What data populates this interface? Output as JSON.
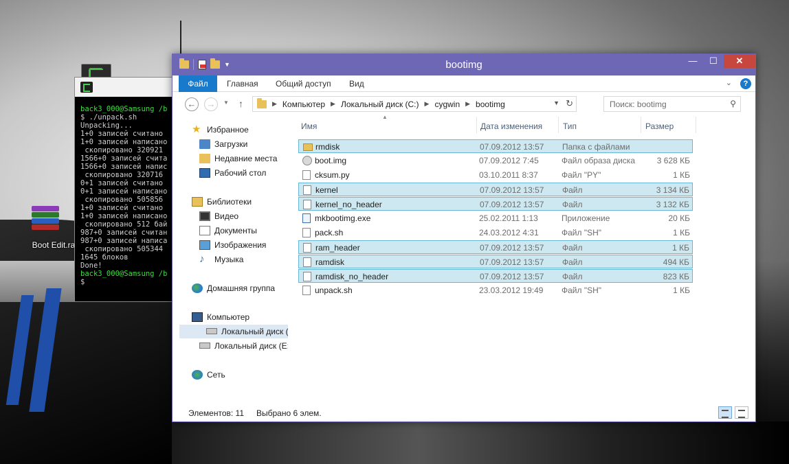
{
  "desktop": {
    "rar_label": "Boot Edit.rar"
  },
  "terminal": {
    "lines": [
      {
        "text": "back3_000@Samsung /b",
        "color": "green"
      },
      {
        "text": "$ ./unpack.sh",
        "color": "white"
      },
      {
        "text": "Unpacking...",
        "color": "white"
      },
      {
        "text": "1+0 записей считано",
        "color": "white"
      },
      {
        "text": "1+0 записей написано",
        "color": "white"
      },
      {
        "text": " скопировано 320921",
        "color": "white"
      },
      {
        "text": "1566+0 записей счита",
        "color": "white"
      },
      {
        "text": "1566+0 записей напис",
        "color": "white"
      },
      {
        "text": " скопировано 320716",
        "color": "white"
      },
      {
        "text": "0+1 записей считано",
        "color": "white"
      },
      {
        "text": "0+1 записей написано",
        "color": "white"
      },
      {
        "text": " скопировано 505856",
        "color": "white"
      },
      {
        "text": "1+0 записей считано",
        "color": "white"
      },
      {
        "text": "1+0 записей написано",
        "color": "white"
      },
      {
        "text": " скопировано 512 бай",
        "color": "white"
      },
      {
        "text": "987+0 записей считан",
        "color": "white"
      },
      {
        "text": "987+0 записей написа",
        "color": "white"
      },
      {
        "text": " скопировано 505344",
        "color": "white"
      },
      {
        "text": "1645 блоков",
        "color": "white"
      },
      {
        "text": "Done!",
        "color": "white"
      },
      {
        "text": "",
        "color": "white"
      },
      {
        "text": "back3_000@Samsung /b",
        "color": "green"
      },
      {
        "text": "$ ",
        "color": "white"
      }
    ]
  },
  "explorer": {
    "title": "bootimg",
    "ribbon_tabs": {
      "file": "Файл",
      "home": "Главная",
      "share": "Общий доступ",
      "view": "Вид"
    },
    "breadcrumb": [
      "Компьютер",
      "Локальный диск (C:)",
      "cygwin",
      "bootimg"
    ],
    "search_placeholder": "Поиск: bootimg",
    "nav": {
      "favorites": "Избранное",
      "downloads": "Загрузки",
      "recent": "Недавние места",
      "desktop": "Рабочий стол",
      "libraries": "Библиотеки",
      "video": "Видео",
      "documents": "Документы",
      "images": "Изображения",
      "music": "Музыка",
      "homegroup": "Домашняя группа",
      "computer": "Компьютер",
      "drive_c": "Локальный диск (C:)",
      "drive_e": "Локальный диск (E:)",
      "network": "Сеть"
    },
    "columns": {
      "name": "Имя",
      "date": "Дата изменения",
      "type": "Тип",
      "size": "Размер"
    },
    "files": [
      {
        "name": "rmdisk",
        "date": "07.09.2012 13:57",
        "type": "Папка с файлами",
        "size": "",
        "icon": "folder",
        "selected": true
      },
      {
        "name": "boot.img",
        "date": "07.09.2012 7:45",
        "type": "Файл образа диска",
        "size": "3 628 КБ",
        "icon": "img",
        "selected": false
      },
      {
        "name": "cksum.py",
        "date": "03.10.2011 8:37",
        "type": "Файл \"PY\"",
        "size": "1 КБ",
        "icon": "py",
        "selected": false
      },
      {
        "name": "kernel",
        "date": "07.09.2012 13:57",
        "type": "Файл",
        "size": "3 134 КБ",
        "icon": "file",
        "selected": true
      },
      {
        "name": "kernel_no_header",
        "date": "07.09.2012 13:57",
        "type": "Файл",
        "size": "3 132 КБ",
        "icon": "file",
        "selected": true
      },
      {
        "name": "mkbootimg.exe",
        "date": "25.02.2011 1:13",
        "type": "Приложение",
        "size": "20 КБ",
        "icon": "exe",
        "selected": false
      },
      {
        "name": "pack.sh",
        "date": "24.03.2012 4:31",
        "type": "Файл \"SH\"",
        "size": "1 КБ",
        "icon": "sh",
        "selected": false
      },
      {
        "name": "ram_header",
        "date": "07.09.2012 13:57",
        "type": "Файл",
        "size": "1 КБ",
        "icon": "file",
        "selected": true
      },
      {
        "name": "ramdisk",
        "date": "07.09.2012 13:57",
        "type": "Файл",
        "size": "494 КБ",
        "icon": "file",
        "selected": true
      },
      {
        "name": "ramdisk_no_header",
        "date": "07.09.2012 13:57",
        "type": "Файл",
        "size": "823 КБ",
        "icon": "file",
        "selected": true
      },
      {
        "name": "unpack.sh",
        "date": "23.03.2012 19:49",
        "type": "Файл \"SH\"",
        "size": "1 КБ",
        "icon": "sh",
        "selected": false
      }
    ],
    "status": {
      "count": "Элементов: 11",
      "selected": "Выбрано 6 элем."
    },
    "colors": {
      "titlebar": "#6e67b5",
      "file_tab": "#1979ca",
      "close": "#c7463e",
      "selection": "#cde8f0"
    }
  }
}
